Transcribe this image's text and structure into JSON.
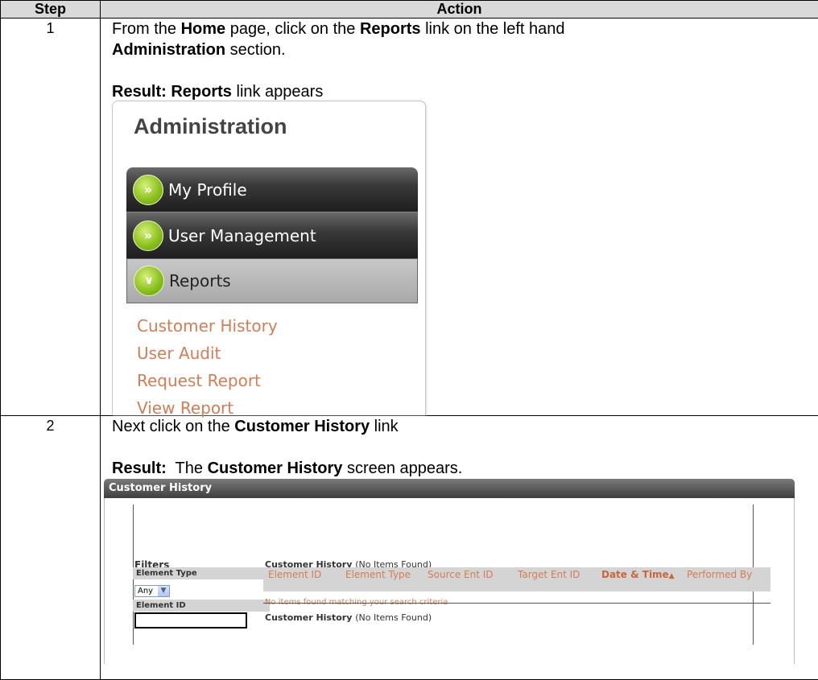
{
  "table": {
    "header_step": "Step",
    "header_action": "Action"
  },
  "step1": {
    "number": "1",
    "line1_pre": "From the ",
    "line1_b1": "Home",
    "line1_mid": " page, click on the ",
    "line1_b2": "Reports",
    "line1_post": " link on the left hand",
    "line2_b": "Administration",
    "line2_post": " section.",
    "result_label": "Result:",
    "result_b": "Reports",
    "result_post": " link appears"
  },
  "admin_panel": {
    "title": "Administration",
    "menu": [
      {
        "label": "My Profile",
        "icon": "double-chevron-right-icon"
      },
      {
        "label": "User Management",
        "icon": "double-chevron-right-icon"
      },
      {
        "label": "Reports",
        "icon": "chevron-down-icon"
      }
    ],
    "links": [
      "Customer History",
      "User Audit",
      "Request Report",
      "View Report"
    ],
    "link_color": "#d47d52"
  },
  "step2": {
    "number": "2",
    "line1_pre": "Next click on the ",
    "line1_b": "Customer History",
    "line1_post": " link",
    "result_label": "Result:",
    "result_pre": "  The ",
    "result_b": "Customer History",
    "result_post": " screen appears."
  },
  "customer_history": {
    "window_title": "Customer History",
    "filters_label": "Filters",
    "element_type_label": "Element Type",
    "element_type_value": "Any",
    "element_id_label": "Element ID",
    "results_title": "Customer History",
    "results_count": "(No Items Found)",
    "columns": [
      "Element ID",
      "Element Type",
      "Source Ent ID",
      "Target Ent ID",
      "Date & Time",
      "Performed By"
    ],
    "no_items_text": "No items found matching your search criteria",
    "footer_title": "Customer History",
    "footer_count": "(No Items Found)"
  }
}
